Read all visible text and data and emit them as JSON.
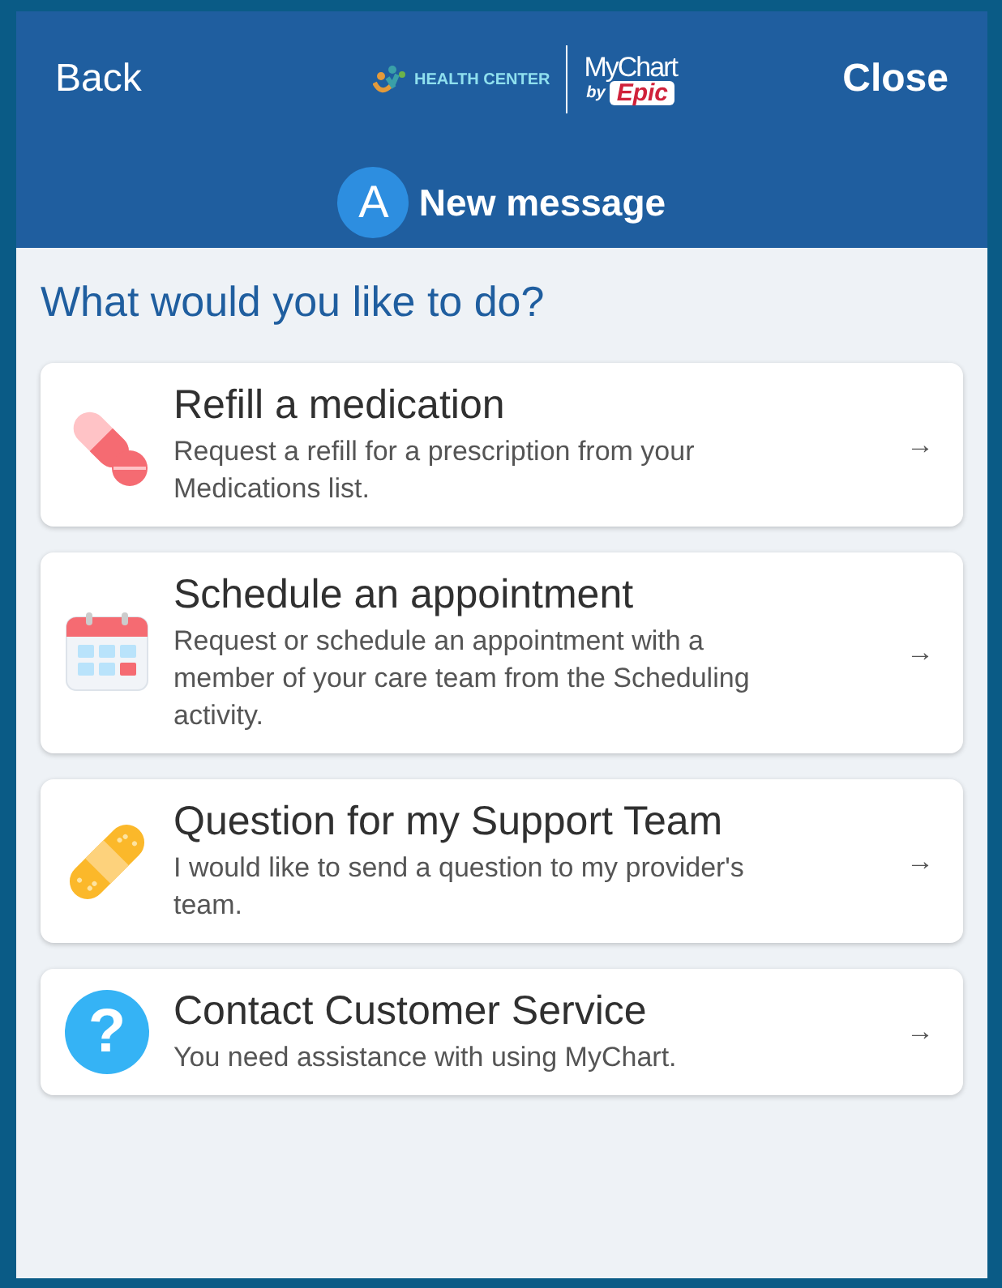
{
  "header": {
    "back": "Back",
    "close": "Close",
    "logo": {
      "org": "HEALTH CENTER",
      "app": "MyChart",
      "by": "by",
      "vendor": "Epic"
    },
    "avatar": "A",
    "title": "New message"
  },
  "heading": "What would you like to do?",
  "options": [
    {
      "kind": "pill",
      "title": "Refill a medication",
      "description": "Request a refill for a prescription from your Medications list.",
      "arrow": "→"
    },
    {
      "kind": "calendar",
      "title": "Schedule an appointment",
      "description": "Request or schedule an appointment with a member of your care team from the Scheduling activity.",
      "arrow": "→"
    },
    {
      "kind": "bandage",
      "title": "Question for my Support Team",
      "description": "I would like to send a question to my provider's team.",
      "arrow": "→"
    },
    {
      "kind": "help",
      "title": "Contact Customer Service",
      "description": "You need assistance with using MyChart.",
      "arrow": "→",
      "icon_text": "?"
    }
  ]
}
